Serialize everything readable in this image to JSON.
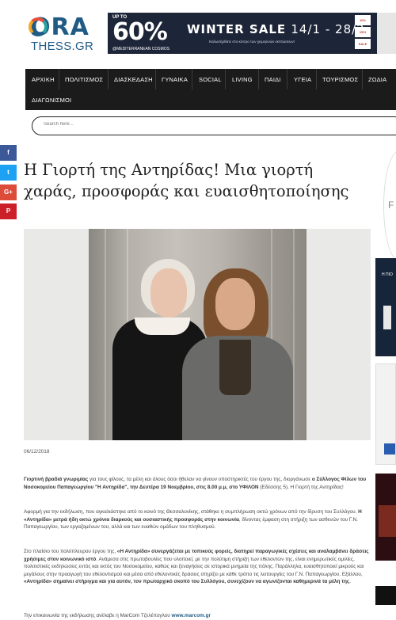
{
  "logo": {
    "ora": "ORA",
    "thess": "THESS.GR"
  },
  "banner": {
    "upto": "UP TO",
    "percent": "60%",
    "headline": "WINTER SALE",
    "dates": "14/1 - 28/2",
    "subtitle": "Καλωσήρθατε στο κέντρο των χειμερινών εκπτώσεων!",
    "brand": "@MEDITERRANEAN COSMOS",
    "badge1": "10%",
    "badge2": "VEO",
    "badge3": "SALE"
  },
  "nav": {
    "items": [
      "ΑΡΧΙΚΗ",
      "ΠΟΛΙΤΙΣΜΟΣ",
      "ΔΙΑΣΚΕΔΑΣΗ",
      "ΓΥΝΑΙΚΑ",
      "SOCIAL",
      "LIVING",
      "ΠΑΙΔΙ",
      "ΥΓΕΙΑ",
      "ΤΟΥΡΙΣΜΟΣ",
      "ΖΩΔΙΑ"
    ],
    "second_row": "ΔΙΑΓΩΝΙΣΜΟΙ"
  },
  "search": {
    "placeholder": "Search here..."
  },
  "social": {
    "facebook": "f",
    "twitter": "t",
    "google": "G+",
    "pinterest": "P"
  },
  "article": {
    "title": "Η Γιορτή της Αντηρίδας! Μια γιορτή χαράς, προσφοράς και ευαισθητοποίησης",
    "date": "06/12/2018",
    "p1": {
      "b1": "Γιορτινή βραδιά γνωριμίας",
      "t1": " για τους φίλους, τα μέλη και όλους όσοι ήθελαν να γίνουν υποστηρικτές του έργου της, διοργάνωσε ",
      "b2": "ο Σύλλογος Φίλων του Νοσοκομείου Παπαγεωργίου \"Η Αντηρίδα\", την Δευτέρα 19 Νοεμβρίου, στις 8.00 μ.μ, στο ΥΦΙΛΟΝ",
      "t2": " (Εδέσσης 5). Η Γιορτή της Αντηρίδας!"
    },
    "p2": {
      "t1": "Αφορμή για την εκδήλωση, που αγκαλιάστηκε από το κοινό της Θεσσαλονίκης, στάθηκε η συμπλήρωση οκτώ χρόνων από την ίδρυση του Συλλόγου. ",
      "b1": "Η «Αντηρίδα» μετρά ήδη οκτώ χρόνια διαρκούς και ουσιαστικής προσφοράς στην κοινωνία",
      "t2": ", δίνοντας έμφαση στη στήριξη των ασθενών του Γ.Ν. Παπαγεωργίου, των εργαζομένων του, αλλά και των ευαθών ομάδων του πληθυσμού."
    },
    "p3": {
      "t1": "Στο πλαίσιο του πολύπλευρου έργου της, ",
      "b1": "«Η Αντηρίδα» συνεργάζεται με τοπικούς φορείς, διατηρεί παραγωγικές σχέσεις και αναλαμβάνει δράσεις χρήσιμες στον κοινωνικό ιστό",
      "t2": ". Ανάμεσα στις πρωτοβουλίες που υλοποιεί, με την πολύτιμη στήριξη των εθελοντών της, είναι ενημερωτικές ομιλίες, πολιτιστικές εκδηλώσεις εντός και εκτός του Νοσοκομείου, καθώς και ξεναγήσεις σε ιστορικά μνημεία της πόλης. Παράλληλα, ευαισθητοποιεί μικρούς και μεγάλους στην προαγωγή του εθελοντισμού και μέσα από εθελοντικές δράσεις στηρίζει με κάθε τρόπο τις λειτουργίες του Γ.Ν. Παπαγεωργίου. Εξάλλου, ",
      "b2": "«Αντηρίδα» σημαίνει στήριγμα και για αυτόν, τον πρωταρχικό σκοπό του Συλλόγου, συνεχίζουν να αγωνίζονται καθημερινά τα μέλη της",
      "t3": "."
    },
    "p4": {
      "t1": "Την επικοινωνία της εκδήλωσης ανέλαβε η MarCom Τζελέπογλου ",
      "link": "www.marcom.gr"
    }
  },
  "right_col": {
    "letter": "F",
    "ad_text": "Η ΠΙΟ"
  },
  "colors": {
    "nav_bg": "#1b1b1b",
    "facebook": "#3b5998",
    "twitter": "#1da1f2",
    "google": "#dd4b39",
    "pinterest": "#cb2027",
    "logo_blue": "#1f5b85",
    "banner_bg": "#1d2538"
  }
}
